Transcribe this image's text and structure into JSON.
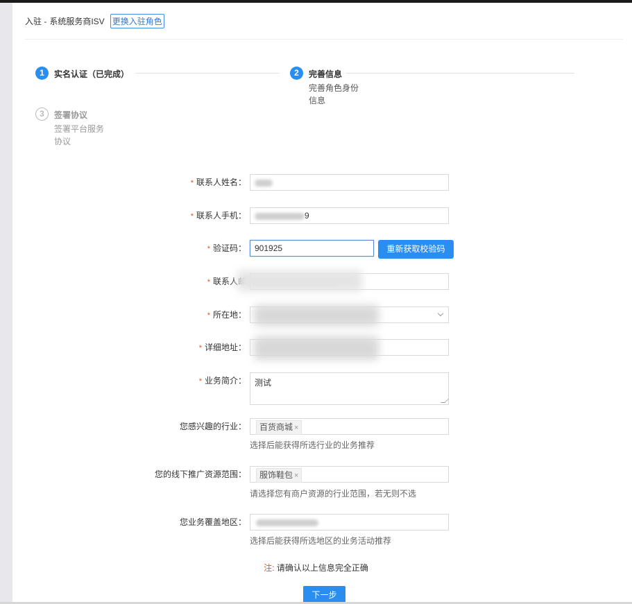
{
  "header": {
    "title": "入驻 -",
    "role": "系统服务商ISV",
    "change_role_label": "更换入驻角色"
  },
  "steps": [
    {
      "number": "1",
      "title": "实名认证（已完成）",
      "desc": ""
    },
    {
      "number": "2",
      "title": "完善信息",
      "desc": "完善角色身份信息"
    },
    {
      "number": "3",
      "title": "签署协议",
      "desc": "签署平台服务协议"
    }
  ],
  "form": {
    "contact_name": {
      "label": "联系人姓名：",
      "value": "",
      "required": true
    },
    "contact_phone": {
      "label": "联系人手机：",
      "value": "9",
      "required": true
    },
    "verify_code": {
      "label": "验证码：",
      "value": "901925",
      "required": true,
      "button_label": "重新获取校验码"
    },
    "contact_email": {
      "label": "联系人邮",
      "value": "",
      "required": true
    },
    "location": {
      "label": "所在地：",
      "value": "",
      "required": true
    },
    "address": {
      "label": "详细地址：",
      "value": "",
      "required": true
    },
    "business_intro": {
      "label": "业务简介：",
      "value": "测试",
      "required": true
    },
    "industry": {
      "label": "您感兴趣的行业：",
      "tags": [
        "百货商城"
      ],
      "hint": "选择后能获得所选行业的业务推荐"
    },
    "offline_resources": {
      "label": "您的线下推广资源范围：",
      "tags": [
        "服饰鞋包"
      ],
      "hint": "请选择您有商户资源的行业范围，若无则不选"
    },
    "coverage_area": {
      "label": "您业务覆盖地区：",
      "value": "",
      "hint": "选择后能获得所选地区的业务活动推荐"
    }
  },
  "note": {
    "mark": "注:",
    "text": "请确认以上信息完全正确"
  },
  "next_button_label": "下一步",
  "colors": {
    "accent": "#2a8ef0",
    "required": "#e4541b"
  }
}
